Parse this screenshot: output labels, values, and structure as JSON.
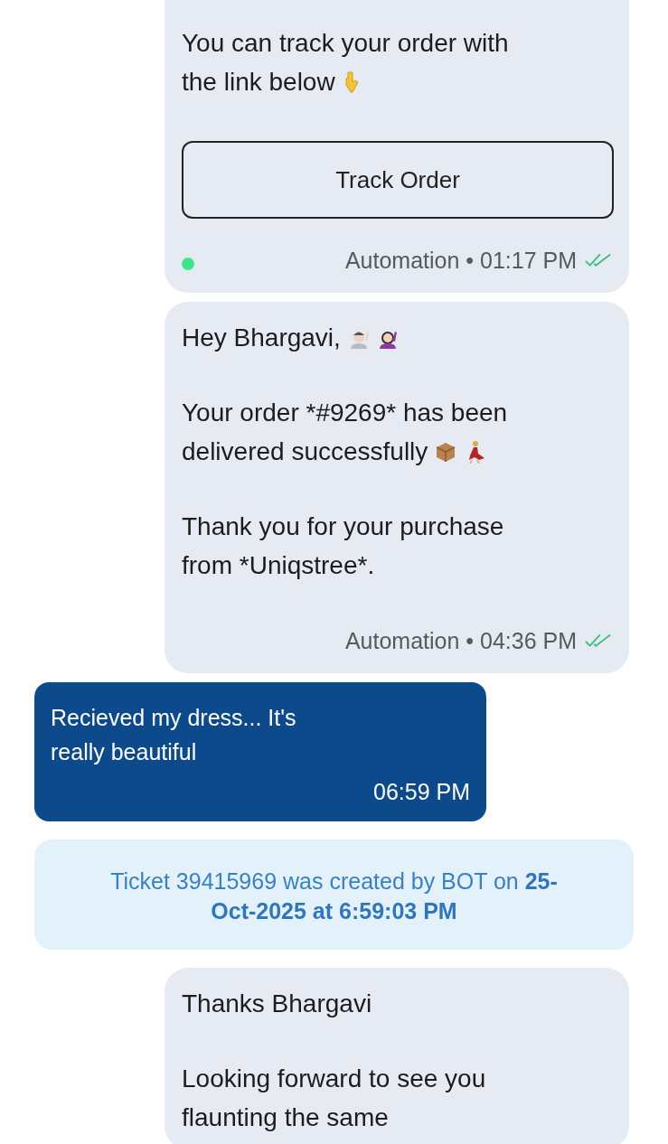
{
  "messages": [
    {
      "kind": "bot",
      "paragraphs": [
        [
          "You can track your order with",
          "the link below"
        ]
      ],
      "button": "Track Order",
      "sender": "Automation",
      "separator": "•",
      "time": "01:17 PM",
      "online": true,
      "read": true
    },
    {
      "kind": "bot",
      "paragraphs": [
        [
          "Hey Bhargavi,"
        ],
        [
          "Your order *#9269* has been",
          "delivered successfully"
        ],
        [
          "Thank you for your purchase",
          "from *Uniqstree*."
        ]
      ],
      "sender": "Automation",
      "separator": "•",
      "time": "04:36 PM",
      "online": false,
      "read": true
    },
    {
      "kind": "customer",
      "paragraphs": [
        [
          "Recieved my dress... It's",
          "really beautiful"
        ]
      ],
      "time": "06:59 PM"
    },
    {
      "kind": "system",
      "text": "Ticket 39415969 was created by BOT on **25-Oct-2025 at 6:59:03 PM**"
    },
    {
      "kind": "bot",
      "paragraphs": [
        [
          "Thanks Bhargavi"
        ],
        [
          "Looking forward to see you",
          "flaunting the same"
        ]
      ]
    }
  ]
}
